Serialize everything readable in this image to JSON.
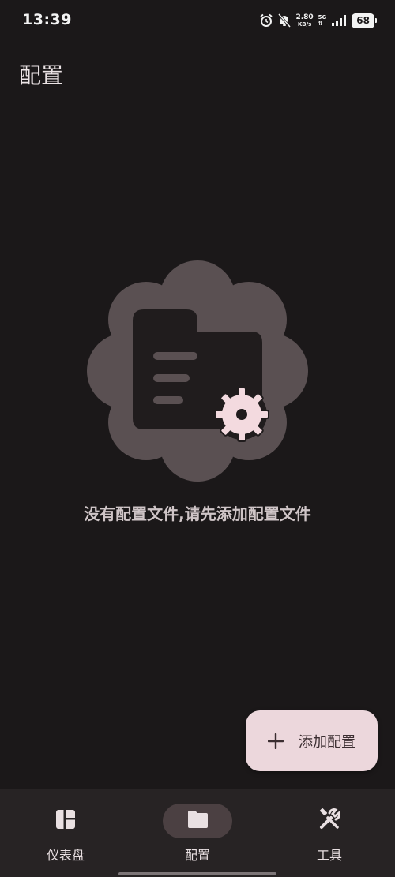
{
  "status_bar": {
    "time": "13:39",
    "net_speed": "2.80",
    "net_speed_unit": "KB/s",
    "network": "5G",
    "battery": "68",
    "icons": [
      "alarm-icon",
      "mute-bell-icon",
      "signal-icon"
    ]
  },
  "header": {
    "title": "配置"
  },
  "empty_state": {
    "message": "没有配置文件,请先添加配置文件",
    "icon": "folder-settings-icon"
  },
  "fab": {
    "label": "添加配置",
    "icon": "plus-icon"
  },
  "bottom_nav": {
    "items": [
      {
        "label": "仪表盘",
        "icon": "dashboard-icon",
        "active": false
      },
      {
        "label": "配置",
        "icon": "folder-icon",
        "active": true
      },
      {
        "label": "工具",
        "icon": "tools-icon",
        "active": false
      }
    ]
  },
  "colors": {
    "background": "#1b1819",
    "fab": "#ecd7dc",
    "nav_background": "#272324",
    "nav_active_pill": "#4b4042",
    "illustration_blob": "#5a5052"
  }
}
